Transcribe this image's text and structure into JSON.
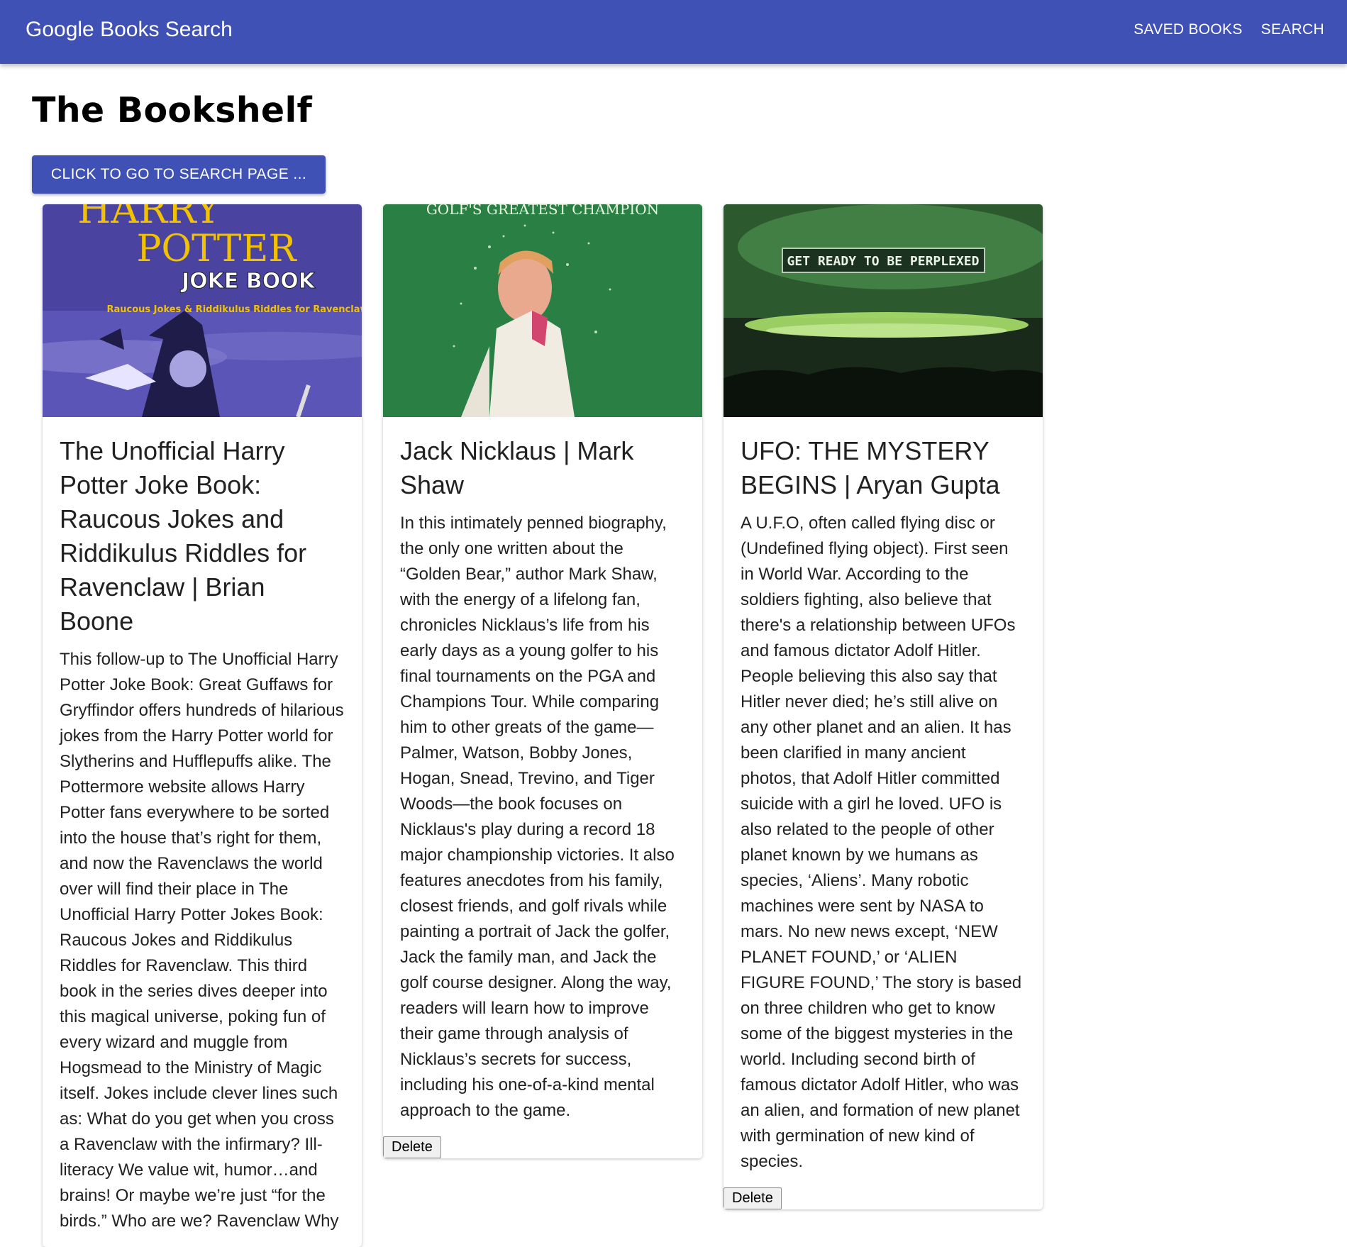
{
  "appbar": {
    "title": "Google Books Search",
    "nav": [
      "SAVED BOOKS",
      "SEARCH"
    ]
  },
  "page": {
    "heading": "The Bookshelf",
    "cta_label": "CLICK TO GO TO SEARCH PAGE ..."
  },
  "books": [
    {
      "title": "The Unofficial Harry Potter Joke Book: Raucous Jokes and Riddikulus Riddles for Ravenclaw | Brian Boone",
      "description": "This follow-up to The Unofficial Harry Potter Joke Book: Great Guffaws for Gryffindor offers hundreds of hilarious jokes from the Harry Potter world for Slytherins and Hufflepuffs alike. The Pottermore website allows Harry Potter fans everywhere to be sorted into the house that’s right for them, and now the Ravenclaws the world over will find their place in The Unofficial Harry Potter Jokes Book: Raucous Jokes and Riddikulus Riddles for Ravenclaw. This third book in the series dives deeper into this magical universe, poking fun of every wizard and muggle from Hogsmead to the Ministry of Magic itself. Jokes include clever lines such as: What do you get when you cross a Ravenclaw with the infirmary? Ill-literacy We value wit, humor…and brains! Or maybe we’re just “for the birds.” Who are we? Ravenclaw Why",
      "cover": {
        "top_text": "HARRY",
        "title_text": "POTTER",
        "sub_text": "JOKE BOOK",
        "tagline": "Raucous Jokes & Riddikulus Riddles for Ravenclaw"
      }
    },
    {
      "title": "Jack Nicklaus | Mark Shaw",
      "description": "In this intimately penned biography, the only one written about the “Golden Bear,” author Mark Shaw, with the energy of a lifelong fan, chronicles Nicklaus’s life from his early days as a young golfer to his final tournaments on the PGA and Champions Tour. While comparing him to other greats of the game—Palmer, Watson, Bobby Jones, Hogan, Snead, Trevino, and Tiger Woods—the book focuses on Nicklaus's play during a record 18 major championship victories. It also features anecdotes from his family, closest friends, and golf rivals while painting a portrait of Jack the golfer, Jack the family man, and Jack the golf course designer. Along the way, readers will learn how to improve their game through analysis of Nicklaus’s secrets for success, including his one-of-a-kind mental approach to the game.",
      "delete_label": "Delete",
      "cover": {
        "top_text": "GOLF'S GREATEST CHAMPION"
      }
    },
    {
      "title": "UFO: THE MYSTERY BEGINS | Aryan Gupta",
      "description": "A U.F.O, often called flying disc or (Undefined flying object). First seen in World War. According to the soldiers fighting, also believe that there's a relationship between UFOs and famous dictator Adolf Hitler. People believing this also say that Hitler never died; he’s still alive on any other planet and an alien. It has been clarified in many ancient photos, that Adolf Hitler committed suicide with a girl he loved. UFO is also related to the people of other planet known by we humans as species, ‘Aliens’. Many robotic machines were sent by NASA to mars. No new news except, ‘NEW PLANET FOUND,’ or ‘ALIEN FIGURE FOUND,’ The story is based on three children who get to know some of the biggest mysteries in the world. Including second birth of famous dictator Adolf Hitler, who was an alien, and formation of new planet with germination of new kind of species.",
      "delete_label": "Delete",
      "cover": {
        "top_text": "GET READY TO BE PERPLEXED"
      }
    }
  ]
}
